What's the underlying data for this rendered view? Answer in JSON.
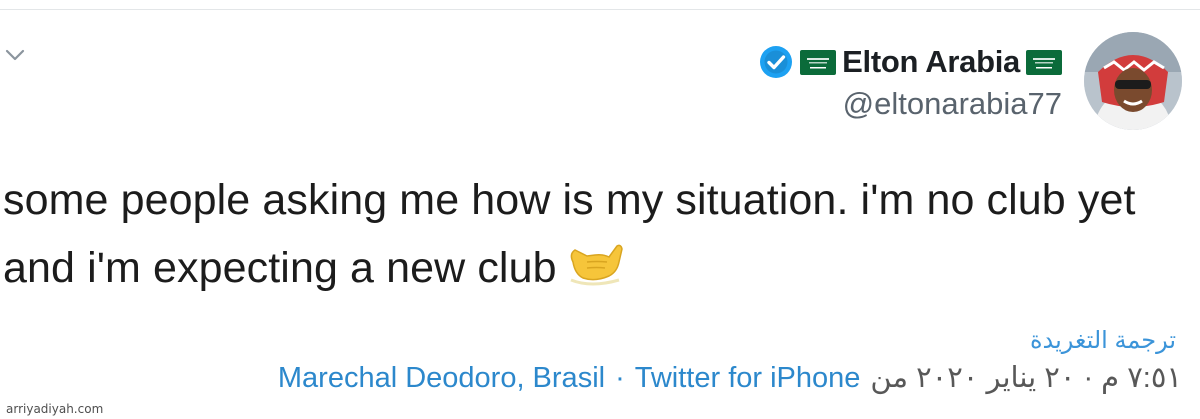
{
  "header": {
    "display_name": "Elton Arabia",
    "handle": "@eltonarabia77",
    "verified": true,
    "flag_icon": "saudi-flag-icon",
    "accent_color": "#1da1f2"
  },
  "tweet": {
    "text": "some people asking me how is my situation.  i'm no club yet and i'm expecting a new club",
    "emoji": "call-me-hand-emoji"
  },
  "translate_label": "ترجمة التغريدة",
  "meta": {
    "timestamp": "٧:٥١ م · ٢٠ يناير ٢٠٢٠ من",
    "source": "Twitter for iPhone",
    "separator": "·",
    "location": "Marechal Deodoro, Brasil"
  },
  "watermark": "arriyadiyah.com"
}
